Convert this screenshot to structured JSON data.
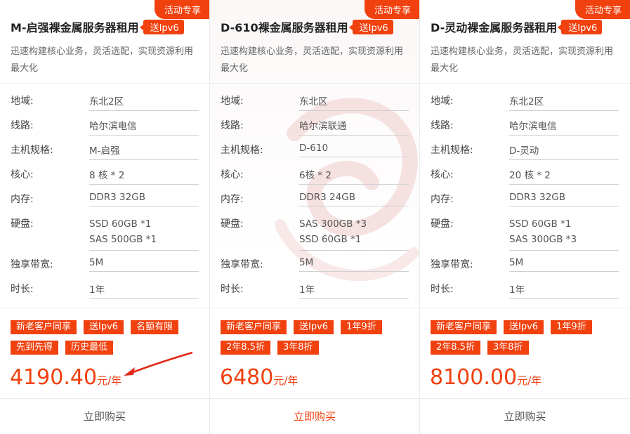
{
  "cards": [
    {
      "corner_tag": "活动专享",
      "title": "M-启强裸金属服务器租用",
      "ipv6_badge": "送Ipv6",
      "desc": "迅速构建核心业务，灵活选配，实现资源利用最大化",
      "specs": {
        "region_label": "地域:",
        "region": "东北2区",
        "line_label": "线路:",
        "line": "哈尔滨电信",
        "model_label": "主机规格:",
        "model": "M-启强",
        "cpu_label": "核心:",
        "cpu": "8 核 * 2",
        "mem_label": "内存:",
        "mem": "DDR3 32GB",
        "disk_label": "硬盘:",
        "disk1": "SSD 60GB *1",
        "disk2": "SAS 500GB *1",
        "bw_label": "独享带宽:",
        "bw": "5M",
        "term_label": "时长:",
        "term": "1年"
      },
      "tags": [
        "新老客户同享",
        "送Ipv6",
        "名额有限",
        "先到先得",
        "历史最低"
      ],
      "price": "4190.40",
      "price_unit": "元/年",
      "buy_label": "立即购买"
    },
    {
      "corner_tag": "活动专享",
      "title": "D-610裸金属服务器租用",
      "ipv6_badge": "送Ipv6",
      "desc": "迅速构建核心业务，灵活选配，实现资源利用最大化",
      "specs": {
        "region_label": "地域:",
        "region": "东北区",
        "line_label": "线路:",
        "line": "哈尔滨联通",
        "model_label": "主机规格:",
        "model": "D-610",
        "cpu_label": "核心:",
        "cpu": "6核 * 2",
        "mem_label": "内存:",
        "mem": "DDR3 24GB",
        "disk_label": "硬盘:",
        "disk1": "SAS 300GB *3",
        "disk2": "SSD 60GB *1",
        "bw_label": "独享带宽:",
        "bw": "5M",
        "term_label": "时长:",
        "term": "1年"
      },
      "tags": [
        "新老客户同享",
        "送Ipv6",
        "1年9折",
        "2年8.5折",
        "3年8折"
      ],
      "price": "6480",
      "price_unit": "元/年",
      "buy_label": "立即购买"
    },
    {
      "corner_tag": "活动专享",
      "title": "D-灵动裸金属服务器租用",
      "ipv6_badge": "送Ipv6",
      "desc": "迅速构建核心业务，灵活选配，实现资源利用最大化",
      "specs": {
        "region_label": "地域:",
        "region": "东北2区",
        "line_label": "线路:",
        "line": "哈尔滨电信",
        "model_label": "主机规格:",
        "model": "D-灵动",
        "cpu_label": "核心:",
        "cpu": "20 核 * 2",
        "mem_label": "内存:",
        "mem": "DDR3 32GB",
        "disk_label": "硬盘:",
        "disk1": "SSD 60GB *1",
        "disk2": "SAS 300GB *3",
        "bw_label": "独享带宽:",
        "bw": "5M",
        "term_label": "时长:",
        "term": "1年"
      },
      "tags": [
        "新老客户同享",
        "送Ipv6",
        "1年9折",
        "2年8.5折",
        "3年8折"
      ],
      "price": "8100.00",
      "price_unit": "元/年",
      "buy_label": "立即购买"
    }
  ],
  "colors": {
    "accent": "#f0410f",
    "text": "#333333",
    "muted": "#666666",
    "divider": "#ececec"
  },
  "icons": {
    "annotation": "red-arrow-icon",
    "background": "brand-watermark-icon"
  }
}
